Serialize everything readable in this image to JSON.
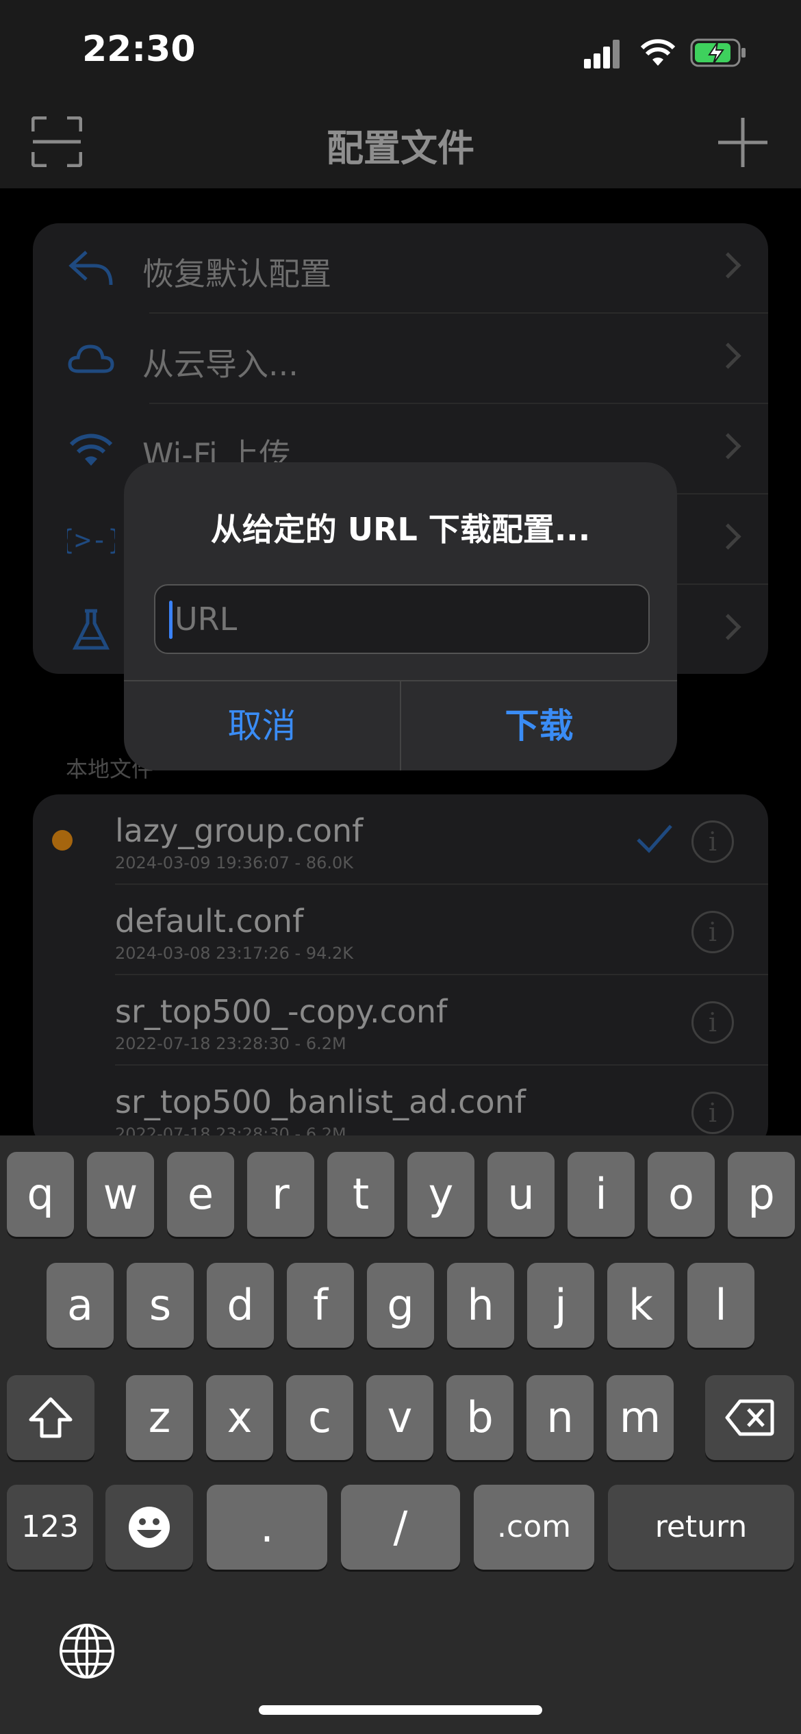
{
  "status_bar": {
    "time": "22:30"
  },
  "nav": {
    "title": "配置文件"
  },
  "menu": [
    {
      "label": "恢复默认配置"
    },
    {
      "label": "从云导入..."
    },
    {
      "label": "Wi-Fi 上传"
    },
    {
      "label": ""
    },
    {
      "label": ""
    }
  ],
  "section_header": "本地文件",
  "files": [
    {
      "name": "lazy_group.conf",
      "meta": "2024-03-09 19:36:07 - 86.0K",
      "selected": true
    },
    {
      "name": "default.conf",
      "meta": "2024-03-08 23:17:26 - 94.2K"
    },
    {
      "name": "sr_top500_-copy.conf",
      "meta": "2022-07-18 23:28:30 - 6.2M"
    },
    {
      "name": "sr_top500_banlist_ad.conf",
      "meta": "2022-07-18 23:28:30 - 6.2M"
    }
  ],
  "dialog": {
    "title": "从给定的 URL 下载配置...",
    "input_placeholder": "URL",
    "input_value": "",
    "cancel_label": "取消",
    "confirm_label": "下载"
  },
  "keyboard": {
    "row1": [
      "q",
      "w",
      "e",
      "r",
      "t",
      "y",
      "u",
      "i",
      "o",
      "p"
    ],
    "row2": [
      "a",
      "s",
      "d",
      "f",
      "g",
      "h",
      "j",
      "k",
      "l"
    ],
    "row3": [
      "z",
      "x",
      "c",
      "v",
      "b",
      "n",
      "m"
    ],
    "numbers_label": "123",
    "dot_label": ".",
    "slash_label": "/",
    "dotcom_label": ".com",
    "return_label": "return"
  },
  "colors": {
    "accent": "#3a8cf5",
    "selected_dot": "#c8780a"
  }
}
